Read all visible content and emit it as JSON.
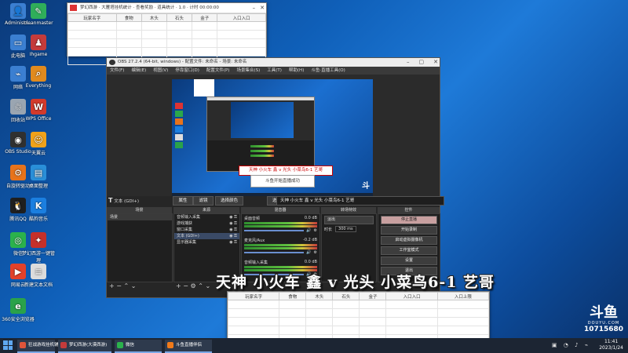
{
  "desktop_icons": [
    {
      "label": "Administr...",
      "color": "#3b7fd1",
      "glyph": "👤"
    },
    {
      "label": "cleanmaster",
      "color": "#2fae5a",
      "glyph": "✎"
    },
    {
      "label": "此电脑",
      "color": "#3b7fd1",
      "glyph": "▭"
    },
    {
      "label": "Ihgame",
      "color": "#c43b3b",
      "glyph": "♟"
    },
    {
      "label": "网络",
      "color": "#3b7fd1",
      "glyph": "⌁"
    },
    {
      "label": "Everything",
      "color": "#e08a1e",
      "glyph": "⌕"
    },
    {
      "label": "回收站",
      "color": "#9aa5b1",
      "glyph": "♲"
    },
    {
      "label": "WPS Office",
      "color": "#d33a2c",
      "glyph": "W"
    },
    {
      "label": "OBS Studio",
      "color": "#303030",
      "glyph": "◉"
    },
    {
      "label": "天翼云",
      "color": "#f0a21a",
      "glyph": "☺"
    },
    {
      "label": "自旋转驱动",
      "color": "#e7731b",
      "glyph": "⚙"
    },
    {
      "label": "桌面整理",
      "color": "#2a8fd8",
      "glyph": "▤"
    },
    {
      "label": "腾讯QQ",
      "color": "#1f1f1f",
      "glyph": "🐧"
    },
    {
      "label": "酷狗音乐",
      "color": "#1b7fe0",
      "glyph": "K"
    },
    {
      "label": "微信",
      "color": "#2bb24c",
      "glyph": "◎"
    },
    {
      "label": "梦幻西游一键管理",
      "color": "#c4302b",
      "glyph": "✦"
    },
    {
      "label": "网易云",
      "color": "#e3412a",
      "glyph": "▶"
    },
    {
      "label": "新建文本文档",
      "color": "#dcdcdc",
      "glyph": "≡"
    },
    {
      "label": "360安全浏览器",
      "color": "#2aa24a",
      "glyph": "e"
    }
  ],
  "top_window": {
    "title": "梦幻西游 · 大雁塔挂机统计 · 查看奖励 · 道具统计 · 1.0 · 计时 00:00:00",
    "columns": [
      "玩家名字",
      "食物",
      "木头",
      "石头",
      "金子",
      "入口入口"
    ]
  },
  "bottom_window": {
    "columns": [
      "玩家名字",
      "食物",
      "木头",
      "石头",
      "金子",
      "入口入口",
      "入口上限"
    ]
  },
  "obs": {
    "title": "OBS 27.2.4 (64-bit, windows) - 配置文件: 未命名 - 场景: 未命名",
    "menu": [
      "文件(F)",
      "编辑(E)",
      "视图(V)",
      "停靠窗口(D)",
      "配置文件(P)",
      "场景集合(S)",
      "工具(T)",
      "帮助(H)",
      "斗鱼·直播工具(O)"
    ],
    "preview_scroll_text": "天神 小火车 鑫 v 光头 小菜鸟6-1 艺哥",
    "preview_popup": "斗鱼开始直播成功",
    "source_label": "文本 (GDI+)",
    "tb_properties": "属性",
    "tb_filters": "滤镜",
    "tb_select_color": "选择颜色",
    "tb_select_font": "选择字体",
    "tb_text_value": "天神 小火车 鑫 v 光头 小菜鸟6-1 艺哥",
    "docks": {
      "scenes": "场景",
      "sources": "来源",
      "mixer": "混音器",
      "transitions": "转场特效",
      "controls": "控件"
    },
    "scene_items": [
      "场景"
    ],
    "source_items": [
      "音频输入采集",
      "游戏捕获",
      "窗口采集",
      "文本 (GDI+)",
      "显示器采集"
    ],
    "mixer_tracks": [
      {
        "name": "桌面音频",
        "db": "0.0 dB"
      },
      {
        "name": "麦克风/Aux",
        "db": "-0.2 dB"
      },
      {
        "name": "音频输入采集",
        "db": "0.0 dB"
      }
    ],
    "transition_name": "淡出",
    "duration_label": "时长",
    "duration_value": "300 ms",
    "control_buttons": [
      "停止直播",
      "开始录制",
      "启动虚拟摄像机",
      "工作室模式",
      "设置",
      "退出"
    ],
    "accent_live": "#c8a0a0"
  },
  "overlay_text": "天神 小火车 鑫 v 光头 小菜鸟6-1 艺哥",
  "douyu": {
    "logo": "斗鱼",
    "site": "DOUYU.COM",
    "room": "10715680"
  },
  "taskbar": {
    "items": [
      "狂战游戏挂机辅助平台",
      "梦幻西游(大漠西游)",
      "微信",
      "斗鱼直播伴侣"
    ],
    "time": "11:41",
    "date": "2023/1/24"
  }
}
